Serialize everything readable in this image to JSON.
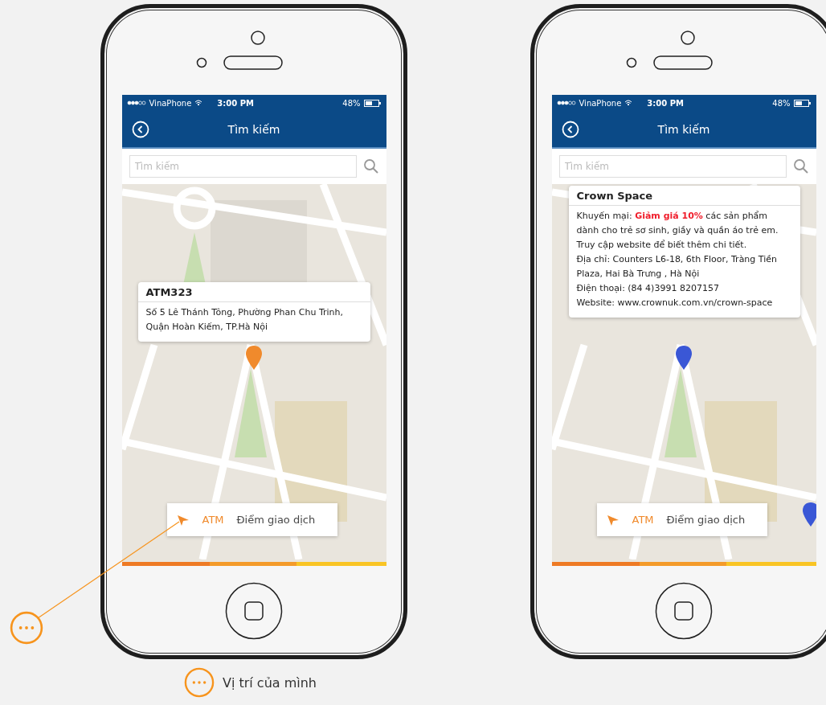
{
  "phones": [
    {
      "status_bar": {
        "carrier": "VinaPhone",
        "time": "3:00 PM",
        "battery": "48%"
      },
      "header": {
        "title": "Tìm kiếm"
      },
      "search": {
        "placeholder": "Tìm kiếm"
      },
      "popup": {
        "kind": "compact",
        "title": "ATM323",
        "lines": [
          "Số 5 Lê Thánh Tông, Phường Phan Chu Trinh, Quận Hoàn Kiếm, TP.Hà Nội"
        ]
      },
      "pins": [
        {
          "kind": "center",
          "color": "#f08a2c"
        }
      ],
      "bottom_bar": {
        "tabs": [
          {
            "label": "ATM",
            "selected": true
          },
          {
            "label": "Điểm giao dịch",
            "selected": false
          }
        ]
      }
    },
    {
      "status_bar": {
        "carrier": "VinaPhone",
        "time": "3:00 PM",
        "battery": "48%"
      },
      "header": {
        "title": "Tìm kiếm"
      },
      "search": {
        "placeholder": "Tìm kiếm"
      },
      "popup": {
        "kind": "wide",
        "title": "Crown Space",
        "lines": [
          "Khuyến mại: **Giảm giá 10%**  các sản phẩm dành cho trẻ sơ sinh, giầy và quần áo trẻ em. Truy cập website để biết thêm chi tiết.",
          "Địa chỉ: Counters L6-18, 6th Floor, Tràng Tiền Plaza, Hai Bà Trưng , Hà Nội",
          "Điện thoại: (84 4)3991 8207157",
          "Website: www.crownuk.com.vn/crown-space"
        ]
      },
      "pins": [
        {
          "kind": "center",
          "color": "#3a57d6"
        },
        {
          "kind": "edge",
          "color": "#3a57d6"
        }
      ],
      "bottom_bar": {
        "tabs": [
          {
            "label": "ATM",
            "selected": true
          },
          {
            "label": "Điểm giao dịch",
            "selected": false
          }
        ]
      }
    }
  ],
  "legend": {
    "label": "Vị trí của mình"
  }
}
